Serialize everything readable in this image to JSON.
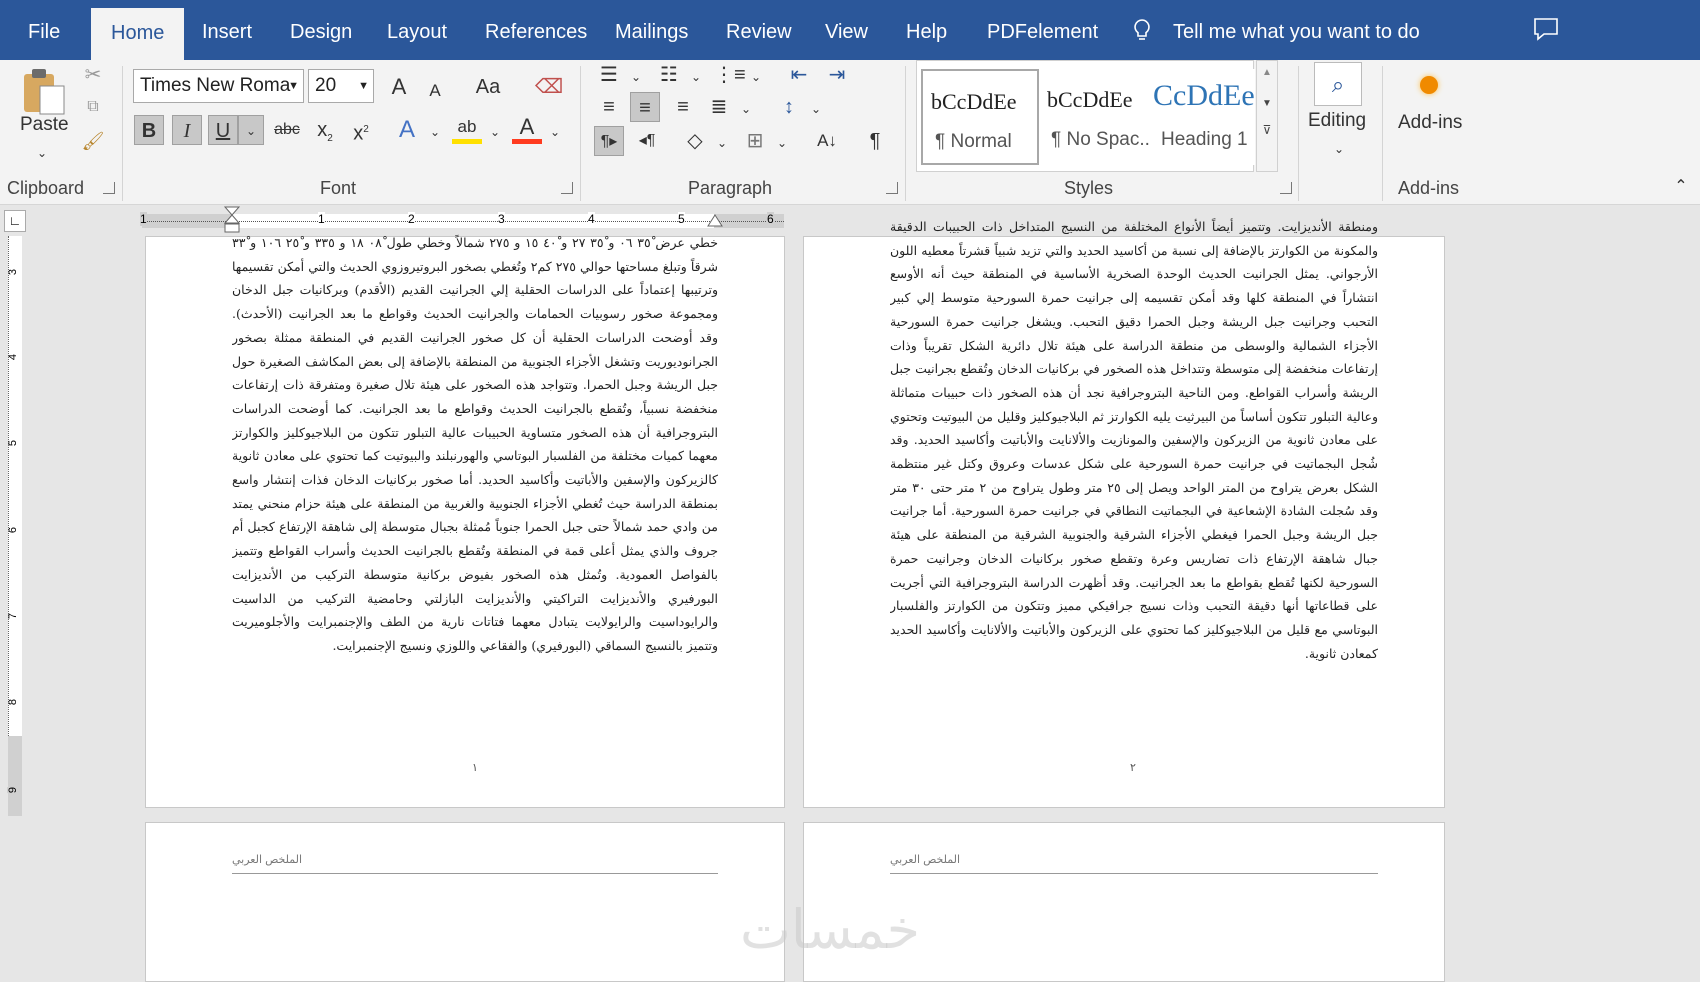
{
  "tabs": [
    "File",
    "Home",
    "Insert",
    "Design",
    "Layout",
    "References",
    "Mailings",
    "Review",
    "View",
    "Help",
    "PDFelement"
  ],
  "tell_me": "Tell me what you want to do",
  "clipboard": {
    "paste": "Paste",
    "label": "Clipboard"
  },
  "font": {
    "name": "Times New Roma",
    "size": "20",
    "label": "Font",
    "grow": "A",
    "shrink": "A",
    "case": "Aa",
    "bold": "B",
    "italic": "I",
    "underline": "U",
    "strike": "abc",
    "sub": "x",
    "sup": "x",
    "sub_digit": "2",
    "sup_digit": "2",
    "effect": "A",
    "highlight": "ab",
    "color": "A"
  },
  "paragraph": {
    "label": "Paragraph"
  },
  "styles": {
    "label": "Styles",
    "items": [
      {
        "preview": "bCcDdEe",
        "name": "¶ Normal"
      },
      {
        "preview": "bCcDdEe",
        "name": "¶ No Spac..."
      },
      {
        "preview": "CcDdEe",
        "name": "Heading 1"
      }
    ]
  },
  "editing": {
    "label": "Editing"
  },
  "addins": {
    "button": "Add-ins",
    "label": "Add-ins"
  },
  "ruler": {
    "numbers": [
      "1",
      "1",
      "2",
      "3",
      "4",
      "5",
      "6"
    ]
  },
  "vruler": {
    "numbers": [
      "3",
      "4",
      "5",
      "6",
      "7",
      "8",
      "9"
    ]
  },
  "page1": {
    "text": "خطي عرض ٣٥ْ ٠٦ و ٣٥ْ ٢٧ و ٤٠ْ ١٥ و ٢٧٥ شمالاً وخطي طول ٠٨ْ ١٨ و ٣٣٥ و ٢٥ْ ١٠٦ و ٣٣ْ شرقاً وتبلغ مساحتها حوالي ٢٧٥ كم٢ وتُغطي بصخور البروتيروزوي الحديث والتي أمكن تقسيمها وترتيبها إعتماداً على الدراسات الحقلية إلي الجرانيت القديم (الأقدم) وبركانيات جبل الدخان ومجموعة صخور رسوبيات الحمامات والجرانيت الحديث وقواطع ما بعد الجرانيت (الأحدث). وقد أوضحت الدراسات الحقلية أن كل صخور الجرانيت القديم في المنطقة ممثلة بصخور الجرانوديوريت وتشغل الأجزاء الجنوبية من المنطقة بالإضافة إلى بعض المكاشف الصغيرة حول جبل الريشة وجبل الحمرا. وتتواجد هذه الصخور على هيئة تلال صغيرة ومتفرقة ذات إرتفاعات منخفضة نسبياً، وتُقطع بالجرانيت الحديث وقواطع ما بعد الجرانيت. كما أوضحت الدراسات البتروجرافية أن هذه الصخور متساوية الحبيبات عالية التبلور تتكون من البلاجيوكليز والكوارتز معهما كميات مختلفة من الفلسبار البوتاسي والهورنبلند والبيوتيت كما تحتوي على معادن ثانوية كالزيركون والإسفين والأباتيت وأكاسيد الحديد. أما صخور بركانيات الدخان فذات إنتشار واسع بمنطقة الدراسة حيث تُغطي الأجزاء الجنوبية والغربية من المنطقة على هيئة حزام منحني يمتد من وادي حمد شمالاً حتى جبل الحمرا جنوباً مُمثلة بجبال متوسطة إلى شاهقة الإرتفاع كجبل أم جروف والذي يمثل أعلى قمة في المنطقة وتُقطع بالجرانيت الحديث وأسراب القواطع وتتميز بالفواصل العمودية. وتُمثل هذه الصخور بفيوض بركانية متوسطة التركيب من الأنديزايت البورفيري والأنديزايت التراكيتي والأنديزايت البازلتي وحامضية التركيب من الداسيت والرايوداسيت والرايولايت يتبادل معهما فتاتات نارية من الطف والإجنمبرايت والأجلوميريت وتتميز بالنسيج السماقي (البورفيري) والفقاعي واللوزي ونسيج الإجنمبرايت.",
    "num": "١"
  },
  "page2": {
    "text": "ومنطقة الأنديزايت. وتتميز أيضاً الأنواع المختلفة من النسيج المتداخل ذات الحبيبات الدقيقة والمكونة من الكوارتز بالإضافة إلى نسبة من أكاسيد الحديد والتي تزيد شبياً قشرتاً معطيه اللون الأرجواني. يمثل الجرانيت الحديث الوحدة الصخرية الأساسية في المنطقة حيث أنه الأوسع انتشاراً في المنطقة كلها وقد أمكن تقسيمه إلى جرانيت حمرة السورحية متوسط إلي كبير التحبب وجرانيت جبل الريشة وجبل الحمرا دقيق التحبب. ويشغل جرانيت حمرة السورحية الأجزاء الشمالية والوسطى من منطقة الدراسة على هيئة تلال دائرية الشكل تقريباً وذات إرتفاعات منخفضة إلى متوسطة وتتداخل هذه الصخور في بركانيات الدخان وتُقطع بجرانيت جبل الريشة وأسراب القواطع. ومن الناحية البتروجرافية نجد أن هذه الصخور ذات حبيبات متماثلة وعالية التبلور تتكون أساساً من البيرثيت يليه الكوارتز ثم البلاجيوكليز وقليل من البيوتيت وتحتوي على معادن ثانوية من الزيركون والإسفين والمونازيت والألانايت والأباتيت وأكاسيد الحديد. وقد شُجل البجماتيت في جرانيت حمرة السورحية على شكل عدسات وعروق وكتل غير منتظمة الشكل بعرض يتراوح من المتر الواحد ويصل إلى ٢٥ متر وطول يتراوح من ٢ متر حتى ٣٠ متر وقد سُجلت الشادة الإشعاعية في البجماتيت النطاقي في جرانيت حمرة السورحية. أما جرانيت جبل الريشة وجبل الحمرا فيغطي الأجزاء الشرقية والجنوبية الشرقية من المنطقة على هيئة جبال شاهقة الإرتفاع ذات تضاريس وعرة وتقطع صخور بركانيات الدخان وجرانيت حمرة السورحية لكنها تُقطع بقواطع ما بعد الجرانيت. وقد أظهرت الدراسة البتروجرافية التي أجريت على قطاعاتها أنها دقيقة التحبب وذات نسيج جرافيكي مميز وتتكون من الكوارتز والفلسبار البوتاسي مع قليل من البلاجيوكليز كما تحتوي على الزيركون والأباتيت والألانايت وأكاسيد الحديد كمعادن ثانوية.",
    "num": "٢"
  },
  "page3": {
    "header": "الملخص العربي"
  },
  "page4": {
    "header": "الملخص العربي"
  },
  "watermark": "خمسات"
}
